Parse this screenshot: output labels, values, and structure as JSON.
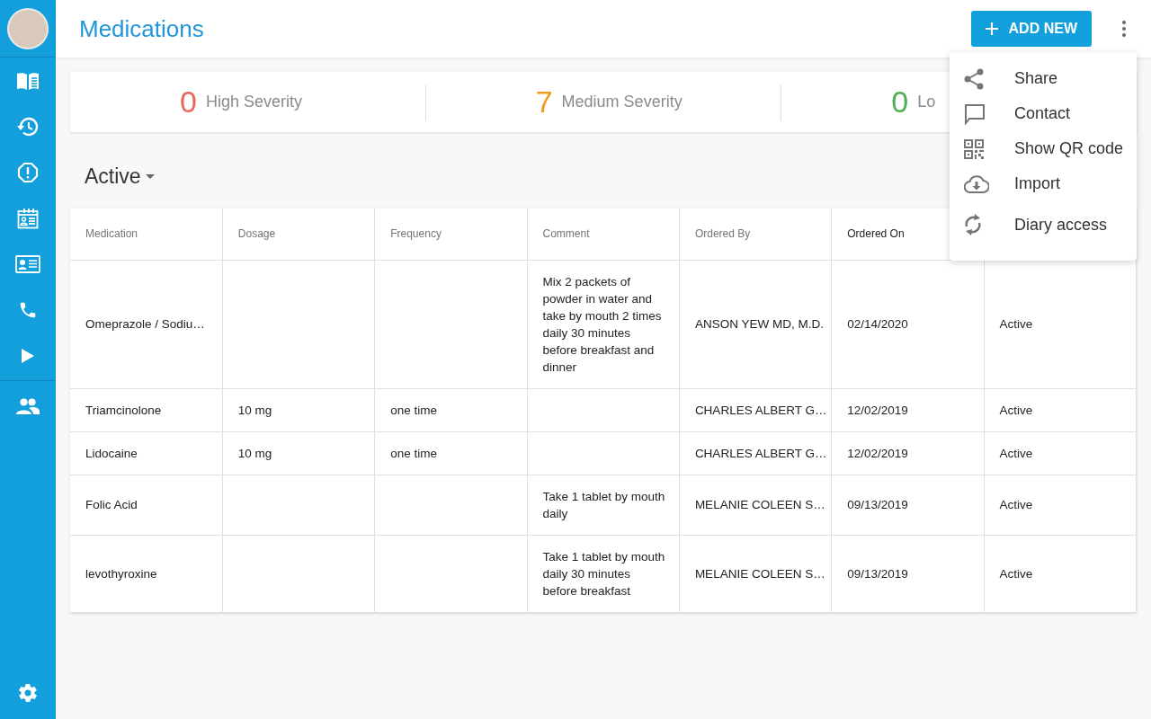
{
  "header": {
    "title": "Medications",
    "add_button": "ADD NEW"
  },
  "severity": [
    {
      "count": "0",
      "label": "High Severity",
      "color": "#e8675d"
    },
    {
      "count": "7",
      "label": "Medium Severity",
      "color": "#f39a1d"
    },
    {
      "count": "0",
      "label": "Lo",
      "color": "#4caf50"
    }
  ],
  "filter": {
    "label": "Active"
  },
  "table": {
    "columns": [
      {
        "label": "Medication",
        "sorted": false
      },
      {
        "label": "Dosage",
        "sorted": false
      },
      {
        "label": "Frequency",
        "sorted": false
      },
      {
        "label": "Comment",
        "sorted": false
      },
      {
        "label": "Ordered By",
        "sorted": false
      },
      {
        "label": "Ordered On",
        "sorted": true
      }
    ],
    "rows": [
      {
        "medication": "Omeprazole / Sodiu…",
        "comment": "Mix 2 packets of powder in water and take by mouth 2 times daily 30 minutes before breakfast and dinner",
        "ordered_by": "ANSON YEW MD, M.D.",
        "ordered_on": "02/14/2020",
        "column_7": "Active"
      },
      {
        "medication": "Triamcinolone",
        "dosage": "10 mg",
        "frequency": "one time",
        "ordered_by": "CHARLES ALBERT G…",
        "ordered_on": "12/02/2019",
        "column_7": "Active"
      },
      {
        "medication": "Lidocaine",
        "dosage": "10 mg",
        "frequency": "one time",
        "ordered_by": "CHARLES ALBERT G…",
        "ordered_on": "12/02/2019",
        "column_7": "Active"
      },
      {
        "medication": "Folic Acid",
        "comment": "Take 1 tablet by mouth daily",
        "ordered_by": "MELANIE COLEEN S…",
        "ordered_on": "09/13/2019",
        "column_7": "Active"
      },
      {
        "medication": "levothyroxine",
        "comment": "Take 1 tablet by mouth daily 30 minutes before breakfast",
        "ordered_by": "MELANIE COLEEN S…",
        "ordered_on": "09/13/2019",
        "column_7": "Active"
      }
    ]
  },
  "menu": {
    "items": [
      {
        "label": "Share"
      },
      {
        "label": "Contact"
      },
      {
        "label": "Show QR code"
      },
      {
        "label": "Import"
      },
      {
        "label": "Diary access"
      }
    ]
  }
}
